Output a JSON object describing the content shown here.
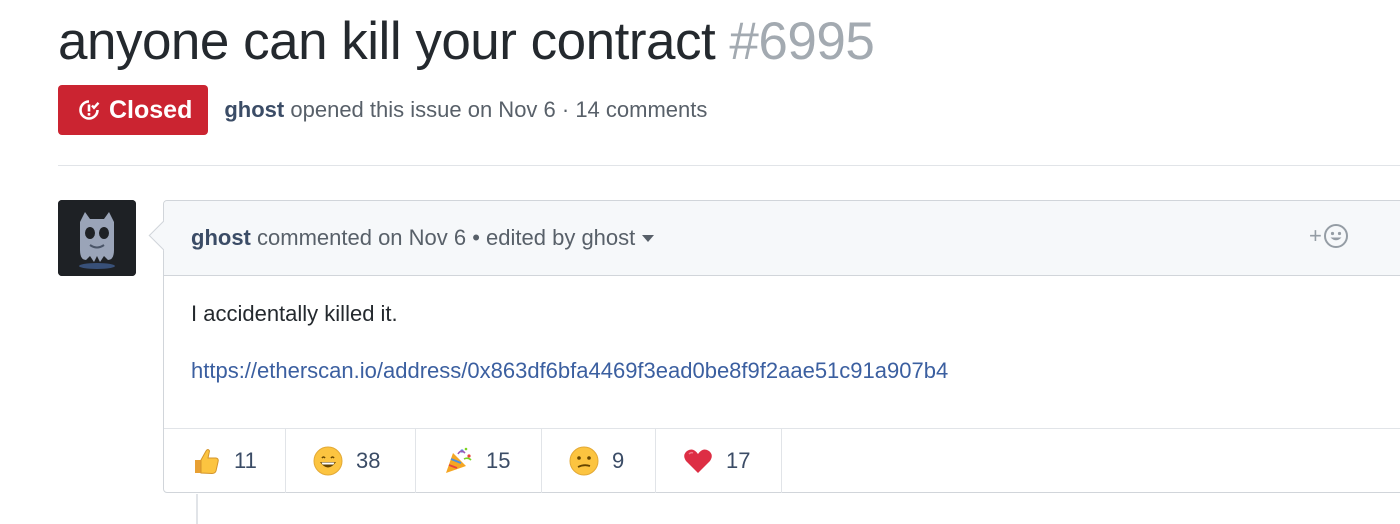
{
  "issue": {
    "title": "anyone can kill your contract",
    "number": "#6995",
    "status": "Closed",
    "status_color": "#cb2431",
    "author": "ghost",
    "opened_text": "opened this issue on Nov 6 · 14 comments"
  },
  "comment": {
    "author": "ghost",
    "meta_text": "commented on Nov 6 • edited by ghost",
    "body_text": "I accidentally killed it.",
    "link": "https://etherscan.io/address/0x863df6bfa4469f3ead0be8f9f2aae51c91a907b4",
    "add_reaction_symbol": "+"
  },
  "reactions": [
    {
      "icon": "thumbs-up-icon",
      "count": "11"
    },
    {
      "icon": "laugh-icon",
      "count": "38"
    },
    {
      "icon": "tada-icon",
      "count": "15"
    },
    {
      "icon": "confused-icon",
      "count": "9"
    },
    {
      "icon": "heart-icon",
      "count": "17"
    }
  ]
}
